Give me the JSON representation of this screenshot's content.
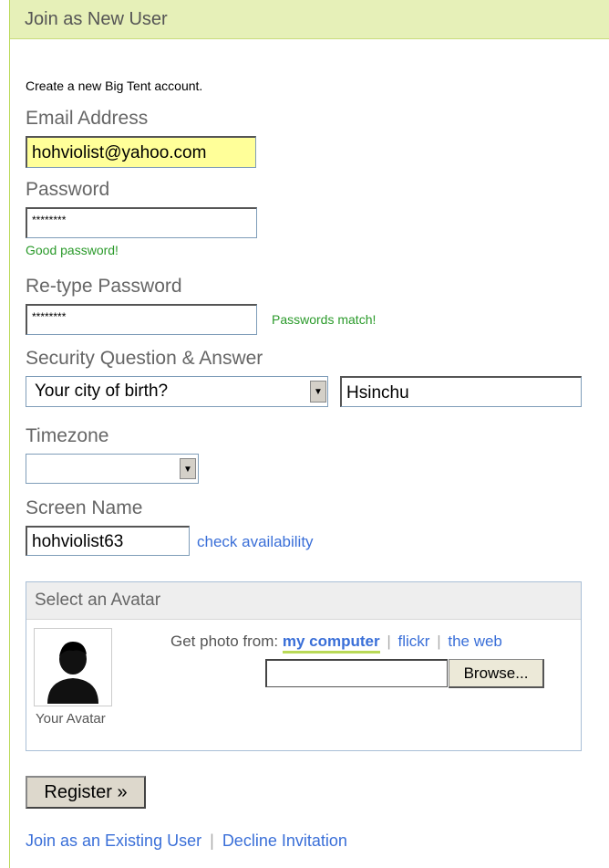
{
  "header": {
    "title": "Join as New User"
  },
  "intro": "Create a new Big Tent account.",
  "email": {
    "label": "Email Address",
    "value": "hohviolist@yahoo.com"
  },
  "password": {
    "label": "Password",
    "value": "********",
    "status": "Good password!"
  },
  "retype": {
    "label": "Re-type Password",
    "value": "********",
    "status": "Passwords match!"
  },
  "security": {
    "label": "Security Question & Answer",
    "question": "Your city of birth?",
    "answer": "Hsinchu"
  },
  "timezone": {
    "label": "Timezone",
    "value": ""
  },
  "screen_name": {
    "label": "Screen Name",
    "value": "hohviolist63",
    "check_link": "check availability"
  },
  "avatar": {
    "heading": "Select an Avatar",
    "caption": "Your Avatar",
    "get_photo_label": "Get photo from:",
    "sources": [
      "my computer",
      "flickr",
      "the web"
    ],
    "file_value": "",
    "browse_label": "Browse..."
  },
  "register_label": "Register »",
  "footer": {
    "existing_link": "Join as an Existing User",
    "decline_link": "Decline Invitation"
  },
  "colors": {
    "accent_green": "#b9d957",
    "link_blue": "#3a6fd8",
    "success_green": "#2a9a2a",
    "email_highlight": "#ffff99"
  },
  "icons": {
    "avatar": "user-silhouette-icon",
    "dropdown": "chevron-down-icon"
  }
}
